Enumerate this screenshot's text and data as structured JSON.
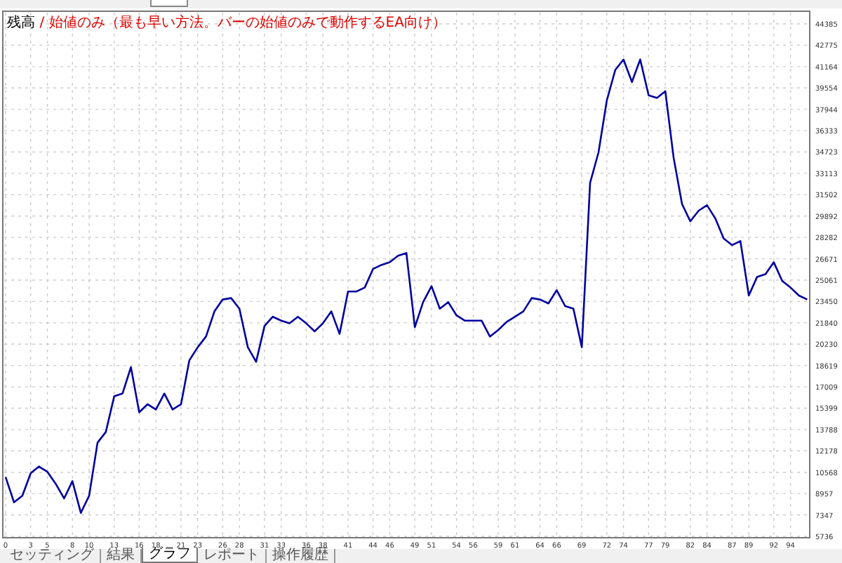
{
  "chart": {
    "title_separator": "/",
    "model_note": "始値のみ（最も早い方法。バーの始値のみで動作するEA向け）",
    "chart_data": {
      "type": "line",
      "grid": true,
      "x": [
        0,
        1,
        2,
        3,
        4,
        5,
        6,
        7,
        8,
        9,
        10,
        11,
        12,
        13,
        14,
        15,
        16,
        17,
        18,
        19,
        20,
        21,
        22,
        23,
        24,
        25,
        26,
        27,
        28,
        29,
        30,
        31,
        32,
        33,
        34,
        35,
        36,
        37,
        38,
        39,
        40,
        41,
        42,
        43,
        44,
        45,
        46,
        47,
        48,
        49,
        50,
        51,
        52,
        53,
        54,
        55,
        56,
        57,
        58,
        59,
        60,
        61,
        62,
        63,
        64,
        65,
        66,
        67,
        68,
        69,
        70,
        71,
        72,
        73,
        74,
        75,
        76,
        77,
        78,
        79,
        80,
        81,
        82,
        83,
        84,
        85,
        86,
        87,
        88,
        89,
        90,
        91,
        92,
        93,
        94,
        95,
        96
      ],
      "series": [
        {
          "name": "残高",
          "color": "#0000a0",
          "values": [
            10200,
            8300,
            8800,
            10500,
            11000,
            10600,
            9700,
            8600,
            9900,
            7500,
            8800,
            12800,
            13600,
            16300,
            16500,
            18500,
            15100,
            15700,
            15300,
            16500,
            15300,
            15700,
            19000,
            20000,
            20800,
            22700,
            23600,
            23700,
            22900,
            20000,
            18900,
            21600,
            22300,
            22000,
            21800,
            22300,
            21800,
            21200,
            21800,
            22700,
            21000,
            24200,
            24200,
            24500,
            25900,
            26200,
            26400,
            26900,
            27100,
            21500,
            23400,
            24600,
            22900,
            23400,
            22400,
            22000,
            22000,
            22000,
            20800,
            21300,
            21900,
            22300,
            22700,
            23700,
            23600,
            23300,
            24300,
            23100,
            22900,
            20000,
            32400,
            34700,
            38600,
            40900,
            41700,
            40000,
            41700,
            39000,
            38800,
            39300,
            34300,
            30800,
            29500,
            30300,
            30700,
            29700,
            28200,
            27700,
            28000,
            23900,
            25300,
            25500,
            26400,
            25000,
            24500,
            23900,
            23600
          ]
        }
      ],
      "xlim": [
        0,
        96.3
      ],
      "ylim": [
        5736,
        44385
      ],
      "xticks": [
        0,
        3,
        5,
        8,
        10,
        13,
        16,
        18,
        21,
        23,
        26,
        28,
        31,
        33,
        36,
        38,
        41,
        44,
        46,
        49,
        51,
        54,
        56,
        59,
        61,
        64,
        66,
        69,
        72,
        74,
        77,
        79,
        82,
        84,
        87,
        89,
        92,
        94
      ],
      "yticks": [
        5736,
        7347,
        8957,
        10568,
        12178,
        13788,
        15399,
        17009,
        18619,
        20230,
        21840,
        23450,
        25061,
        26671,
        28282,
        29892,
        31502,
        33113,
        34723,
        36333,
        37944,
        39554,
        41164,
        42775,
        44385
      ]
    }
  },
  "tabs": [
    {
      "label": "セッティング",
      "selected": false
    },
    {
      "label": "結果",
      "selected": false
    },
    {
      "label": "グラフ",
      "selected": true
    },
    {
      "label": "レポート",
      "selected": false
    },
    {
      "label": "操作履歴",
      "selected": false
    }
  ]
}
